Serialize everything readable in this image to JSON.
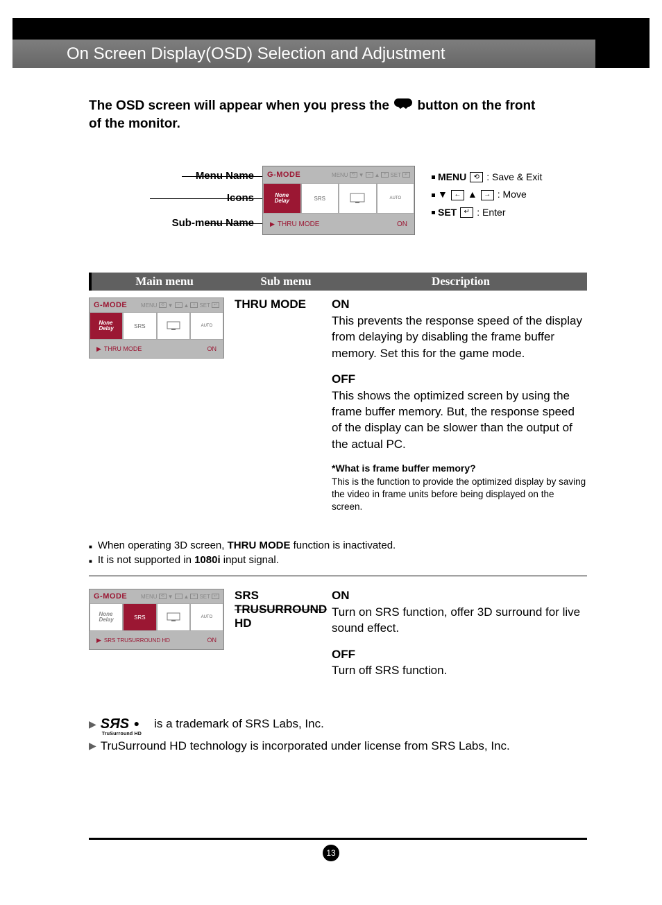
{
  "header": {
    "title": "On Screen Display(OSD) Selection and Adjustment"
  },
  "intro": {
    "line1_a": "The OSD screen will appear when you press the",
    "line1_b": "button on the front",
    "line2": "of the monitor."
  },
  "labels": {
    "menu_name": "Menu Name",
    "icons": "Icons",
    "sub_menu_name": "Sub-menu Name"
  },
  "osd_main": {
    "gmode": "G-MODE",
    "menu_txt": "MENU",
    "set_txt": "SET",
    "submenu": "THRU MODE",
    "value": "ON",
    "icon1": "None\nDelay",
    "icon2": "SRS",
    "icon3": " ",
    "icon4": "AUTO"
  },
  "legend": {
    "menu_lbl": "MENU",
    "menu_desc": ": Save & Exit",
    "move_desc": ": Move",
    "set_lbl": "SET",
    "set_desc": ": Enter"
  },
  "table_header": {
    "main": "Main menu",
    "sub": "Sub menu",
    "desc": "Description"
  },
  "thru": {
    "sub_label": "THRU MODE",
    "on_h": "ON",
    "on_body": "This prevents the response speed of the display from delaying by disabling the frame buffer memory. Set this for the game mode.",
    "off_h": "OFF",
    "off_body": "This shows the optimized screen by using the frame buffer memory. But, the response speed of the display can be slower than the output of the actual PC.",
    "note_h": "*What is frame buffer memory?",
    "note_body": "This is the function to provide the optimized display by saving the video in frame units before being displayed on the screen.",
    "osd_sub": "THRU MODE",
    "osd_val": "ON"
  },
  "bullets": {
    "b1_a": "When operating 3D screen, ",
    "b1_b": "THRU MODE",
    "b1_c": " function is inactivated.",
    "b2_a": "It is not supported in ",
    "b2_b": "1080i",
    "b2_c": " input signal."
  },
  "srs": {
    "sub_label_1": "SRS",
    "sub_label_2": "TRUSURROUND",
    "sub_label_3": "HD",
    "on_h": "ON",
    "on_body": "Turn on SRS function, offer 3D surround for live sound effect.",
    "off_h": "OFF",
    "off_body": "Turn off SRS function.",
    "osd_sub": "SRS TRUSURROUND HD",
    "osd_val": "ON"
  },
  "footnotes": {
    "logo_main": "SЯS",
    "logo_sub": "TruSurround HD",
    "f1": " is a trademark of SRS Labs, Inc.",
    "f2": "TruSurround HD technology is incorporated under license from SRS Labs, Inc."
  },
  "page_number": "13"
}
